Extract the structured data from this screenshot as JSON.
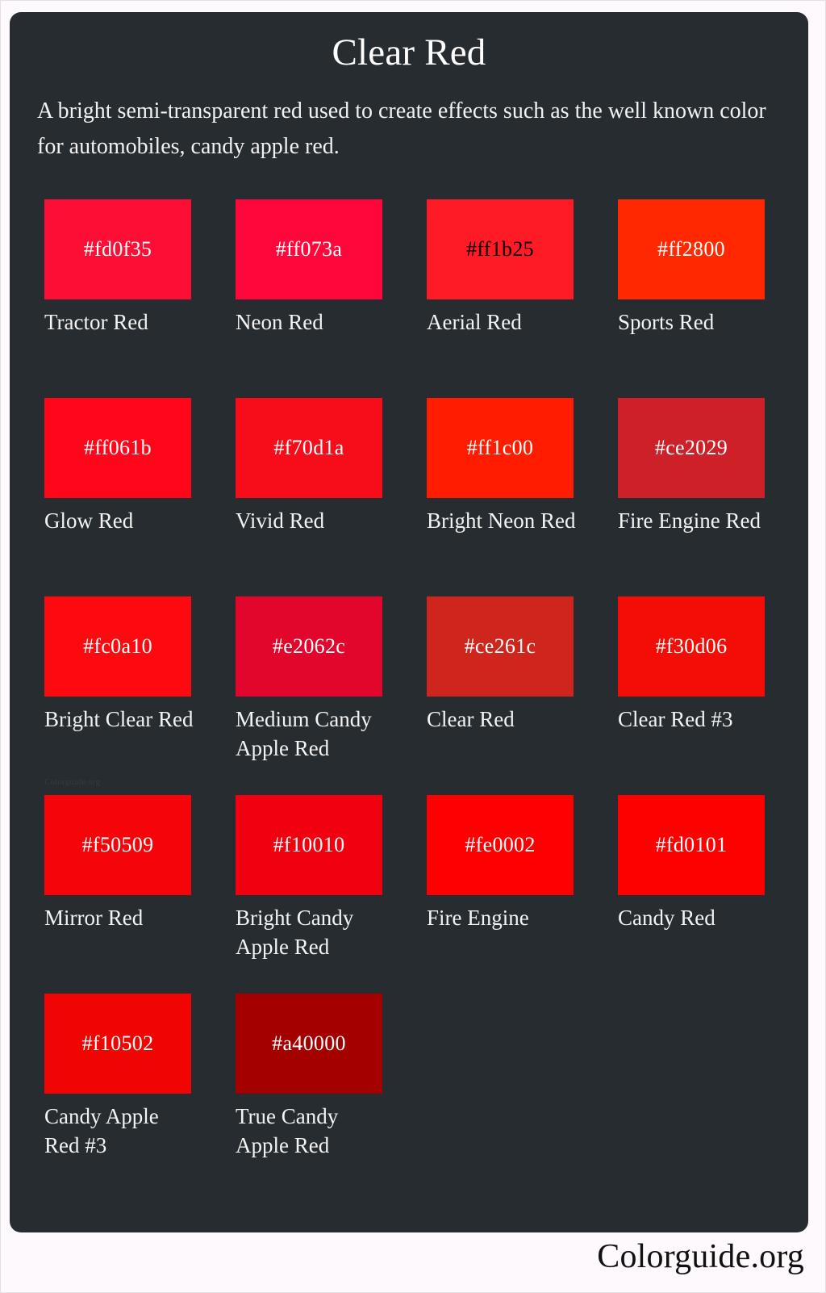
{
  "page": {
    "background": "#fdf9fc",
    "card_background": "#272c30"
  },
  "header": {
    "title": "Clear Red",
    "description": "A bright semi-transparent red used to create effects such as the well known color for automobiles, candy apple red."
  },
  "watermark": {
    "inline_text": "Colorguide.org"
  },
  "footer": {
    "brand": "Colorguide.org"
  },
  "swatches": [
    {
      "hex": "#fd0f35",
      "name": "Tractor Red",
      "text_color": "#ffffff"
    },
    {
      "hex": "#ff073a",
      "name": "Neon Red",
      "text_color": "#ffffff"
    },
    {
      "hex": "#ff1b25",
      "name": "Aerial Red",
      "text_color": "#000000"
    },
    {
      "hex": "#ff2800",
      "name": "Sports Red",
      "text_color": "#ffffff"
    },
    {
      "hex": "#ff061b",
      "name": "Glow Red",
      "text_color": "#ffffff"
    },
    {
      "hex": "#f70d1a",
      "name": "Vivid Red",
      "text_color": "#ffffff"
    },
    {
      "hex": "#ff1c00",
      "name": "Bright Neon Red",
      "text_color": "#ffffff"
    },
    {
      "hex": "#ce2029",
      "name": "Fire Engine Red",
      "text_color": "#ffffff"
    },
    {
      "hex": "#fc0a10",
      "name": "Bright Clear Red",
      "text_color": "#ffffff"
    },
    {
      "hex": "#e2062c",
      "name": "Medium Candy Apple Red",
      "text_color": "#ffffff"
    },
    {
      "hex": "#ce261c",
      "name": "Clear Red",
      "text_color": "#ffffff"
    },
    {
      "hex": "#f30d06",
      "name": "Clear Red #3",
      "text_color": "#ffffff"
    },
    {
      "hex": "#f50509",
      "name": "Mirror Red",
      "text_color": "#ffffff"
    },
    {
      "hex": "#f10010",
      "name": "Bright Candy Apple Red",
      "text_color": "#ffffff"
    },
    {
      "hex": "#fe0002",
      "name": "Fire Engine",
      "text_color": "#ffffff"
    },
    {
      "hex": "#fd0101",
      "name": "Candy Red",
      "text_color": "#ffffff"
    },
    {
      "hex": "#f10502",
      "name": "Candy Apple Red #3",
      "text_color": "#ffffff"
    },
    {
      "hex": "#a40000",
      "name": "True Candy Apple Red",
      "text_color": "#ffffff"
    }
  ]
}
